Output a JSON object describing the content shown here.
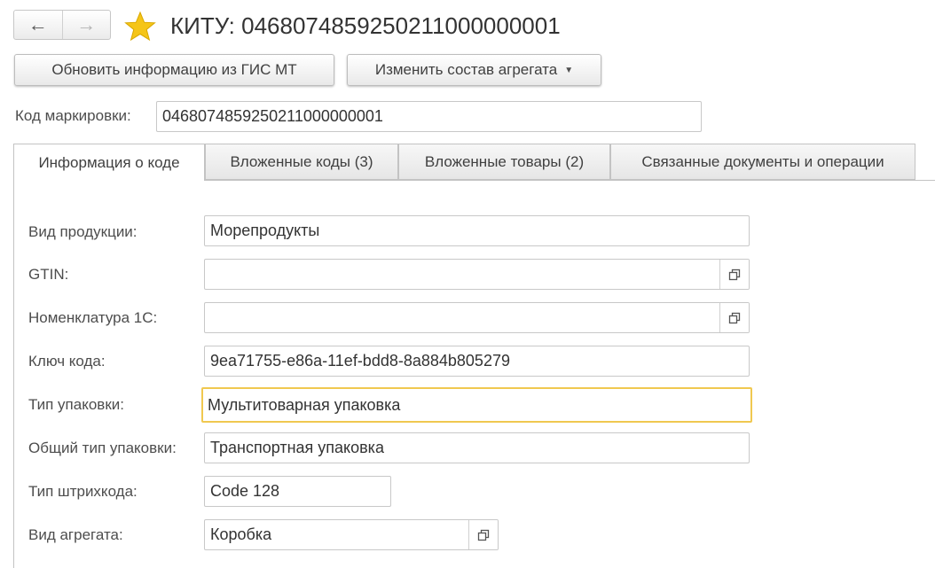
{
  "header": {
    "back_icon": "←",
    "forward_icon": "→",
    "title": "КИТУ: 0468074859250211000000001"
  },
  "toolbar": {
    "refresh_label": "Обновить информацию из ГИС МТ",
    "change_label": "Изменить состав агрегата",
    "caret": "▼"
  },
  "code": {
    "label": "Код маркировки:",
    "value": "0468074859250211000000001"
  },
  "tabs": [
    {
      "label": "Информация о коде",
      "active": true
    },
    {
      "label": "Вложенные коды (3)",
      "active": false
    },
    {
      "label": "Вложенные товары (2)",
      "active": false
    },
    {
      "label": "Связанные документы и операции",
      "active": false
    }
  ],
  "form": {
    "product_type": {
      "label": "Вид продукции:",
      "value": "Морепродукты"
    },
    "gtin": {
      "label": "GTIN:",
      "value": ""
    },
    "nomenclature": {
      "label": "Номенклатура 1С:",
      "value": ""
    },
    "code_key": {
      "label": "Ключ кода:",
      "value": "9ea71755-e86a-11ef-bdd8-8a884b805279"
    },
    "package_type": {
      "label": "Тип упаковки:",
      "value": "Мультитоварная упаковка"
    },
    "general_package_type": {
      "label": "Общий тип упаковки:",
      "value": "Транспортная упаковка"
    },
    "barcode_type": {
      "label": "Тип штрихкода:",
      "value": "Code 128"
    },
    "aggregate_type": {
      "label": "Вид агрегата:",
      "value": "Коробка"
    }
  },
  "colors": {
    "accent_star": "#f5c518",
    "focus_border": "#f0c850"
  }
}
